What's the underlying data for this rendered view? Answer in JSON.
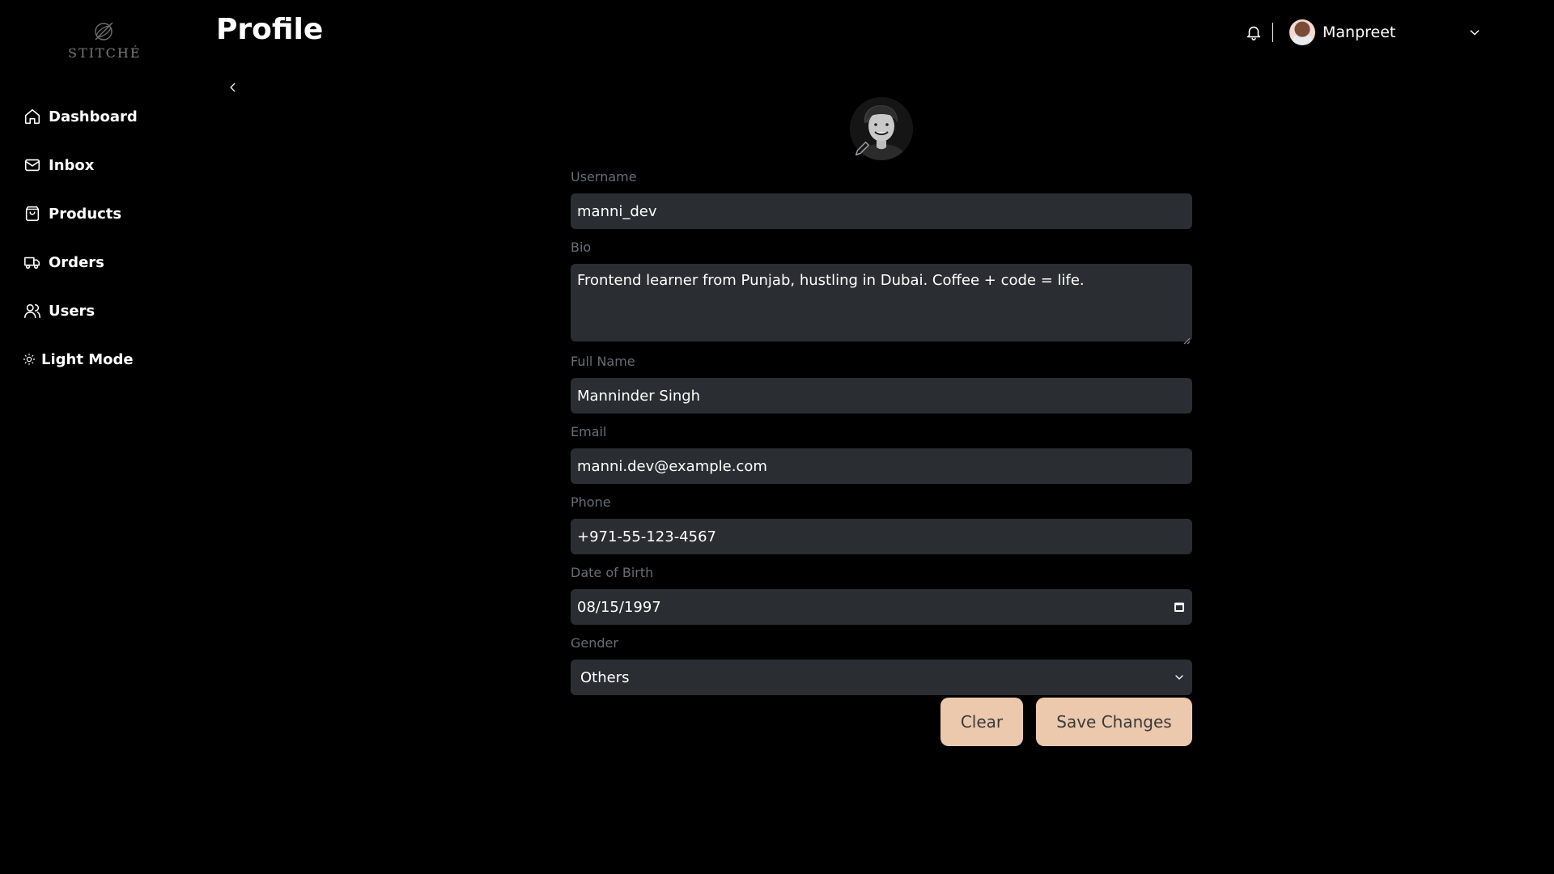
{
  "brand": {
    "name": "STITCHÉ"
  },
  "sidebar": {
    "items": [
      {
        "label": "Dashboard",
        "icon": "home-icon"
      },
      {
        "label": "Inbox",
        "icon": "mail-icon"
      },
      {
        "label": "Products",
        "icon": "shopping-bag-icon"
      },
      {
        "label": "Orders",
        "icon": "truck-icon"
      },
      {
        "label": "Users",
        "icon": "users-icon"
      },
      {
        "label": "Light Mode",
        "icon": "sun-icon"
      }
    ]
  },
  "header": {
    "title": "Profile",
    "user_name": "Manpreet"
  },
  "form": {
    "username": {
      "label": "Username",
      "value": "manni_dev"
    },
    "bio": {
      "label": "Bio",
      "value": "Frontend learner from Punjab, hustling in Dubai. Coffee + code = life."
    },
    "full_name": {
      "label": "Full Name",
      "value": "Manninder Singh"
    },
    "email": {
      "label": "Email",
      "value": "manni.dev@example.com"
    },
    "phone": {
      "label": "Phone",
      "value": "+971-55-123-4567"
    },
    "dob": {
      "label": "Date of Birth",
      "value": "08/15/1997"
    },
    "gender": {
      "label": "Gender",
      "value": "Others"
    }
  },
  "actions": {
    "clear_label": "Clear",
    "save_label": "Save Changes"
  },
  "colors": {
    "background": "#000000",
    "field_bg": "#2a2d31",
    "label_text": "#686d73",
    "button_bg": "#ecc8ac"
  }
}
